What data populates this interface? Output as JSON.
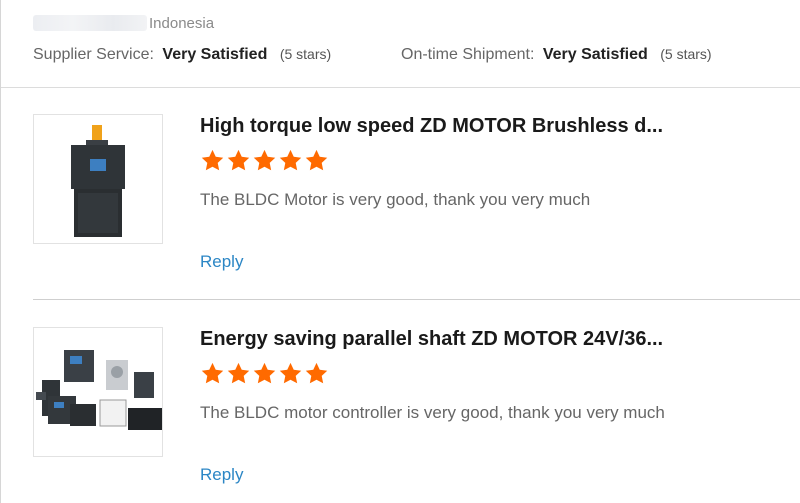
{
  "buyer": {
    "country": "Indonesia"
  },
  "ratings": {
    "supplier_service_label": "Supplier Service:",
    "supplier_service_value": "Very Satisfied",
    "supplier_service_stars": "(5 stars)",
    "shipment_label": "On-time Shipment:",
    "shipment_value": "Very Satisfied",
    "shipment_stars": "(5 stars)"
  },
  "reviews": [
    {
      "title": "High torque low speed ZD MOTOR Brushless d...",
      "stars": 5,
      "comment": "The BLDC Motor is very good, thank you very much",
      "reply_label": "Reply"
    },
    {
      "title": "Energy saving parallel shaft ZD MOTOR 24V/36...",
      "stars": 5,
      "comment": "The BLDC motor controller is very good, thank you very much",
      "reply_label": "Reply"
    }
  ],
  "colors": {
    "star": "#ff6a00",
    "link": "#2b86c5",
    "motor_body": "#2f3438",
    "motor_shaft": "#f0a21a"
  }
}
